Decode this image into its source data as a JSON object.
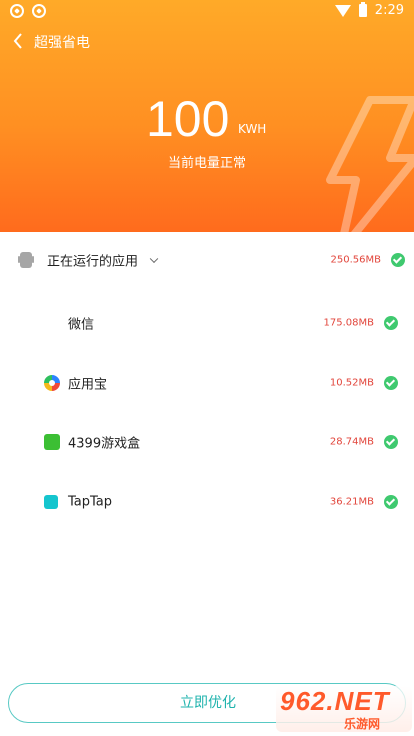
{
  "status_bar": {
    "time": "2:29"
  },
  "header": {
    "title": "超强省电",
    "energy_value": "100",
    "energy_unit": "KWH",
    "status_text": "当前电量正常"
  },
  "running": {
    "label": "正在运行的应用",
    "size": "250.56MB"
  },
  "apps": [
    {
      "name": "微信",
      "size": "175.08MB",
      "icon": "wechat-icon"
    },
    {
      "name": "应用宝",
      "size": "10.52MB",
      "icon": "yingyongbao-icon"
    },
    {
      "name": "4399游戏盒",
      "size": "28.74MB",
      "icon": "4399-icon"
    },
    {
      "name": "TapTap",
      "size": "36.21MB",
      "icon": "taptap-icon"
    }
  ],
  "actions": {
    "optimize_label": "立即优化"
  },
  "colors": {
    "header_top": "#ffaa28",
    "header_bottom": "#ff6b1d",
    "accent_teal": "#1fb3ad",
    "size_red": "#e2463c",
    "check_green": "#3fc96f"
  },
  "watermark": {
    "text": "962.NET",
    "sub": "乐游网"
  }
}
